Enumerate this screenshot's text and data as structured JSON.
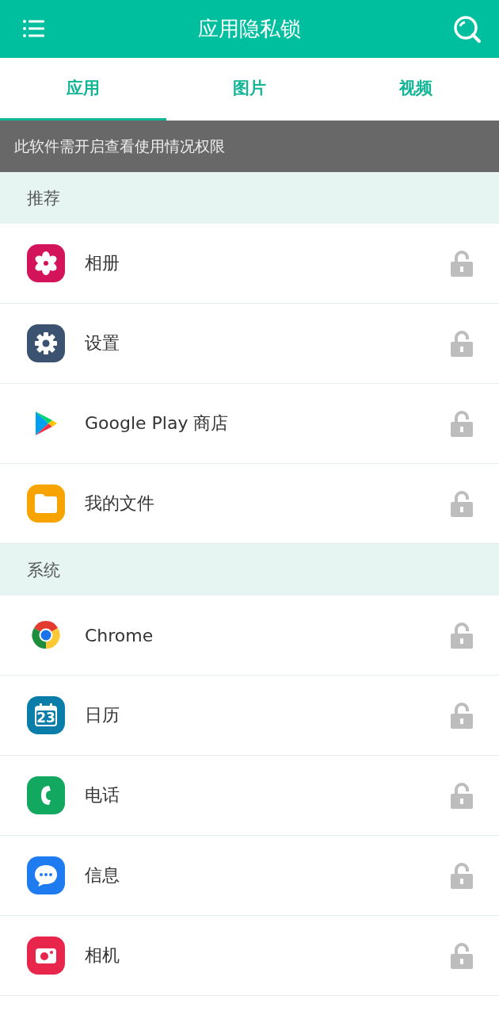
{
  "header": {
    "title": "应用隐私锁"
  },
  "tabs": [
    {
      "label": "应用",
      "selected": true
    },
    {
      "label": "图片",
      "selected": false
    },
    {
      "label": "视频",
      "selected": false
    }
  ],
  "notice": "此软件需开启查看使用情况权限",
  "sections": [
    {
      "title": "推荐",
      "apps": [
        {
          "name": "相册",
          "kind": "gallery",
          "locked": false
        },
        {
          "name": "设置",
          "kind": "settings",
          "locked": false
        },
        {
          "name": "Google Play 商店",
          "kind": "play",
          "locked": false
        },
        {
          "name": "我的文件",
          "kind": "files",
          "locked": false
        }
      ]
    },
    {
      "title": "系统",
      "apps": [
        {
          "name": "Chrome",
          "kind": "chrome",
          "locked": false
        },
        {
          "name": "日历",
          "kind": "calendar",
          "icon_text": "23",
          "locked": false
        },
        {
          "name": "电话",
          "kind": "phone",
          "locked": false
        },
        {
          "name": "信息",
          "kind": "messages",
          "locked": false
        },
        {
          "name": "相机",
          "kind": "camera",
          "locked": false
        }
      ]
    }
  ]
}
